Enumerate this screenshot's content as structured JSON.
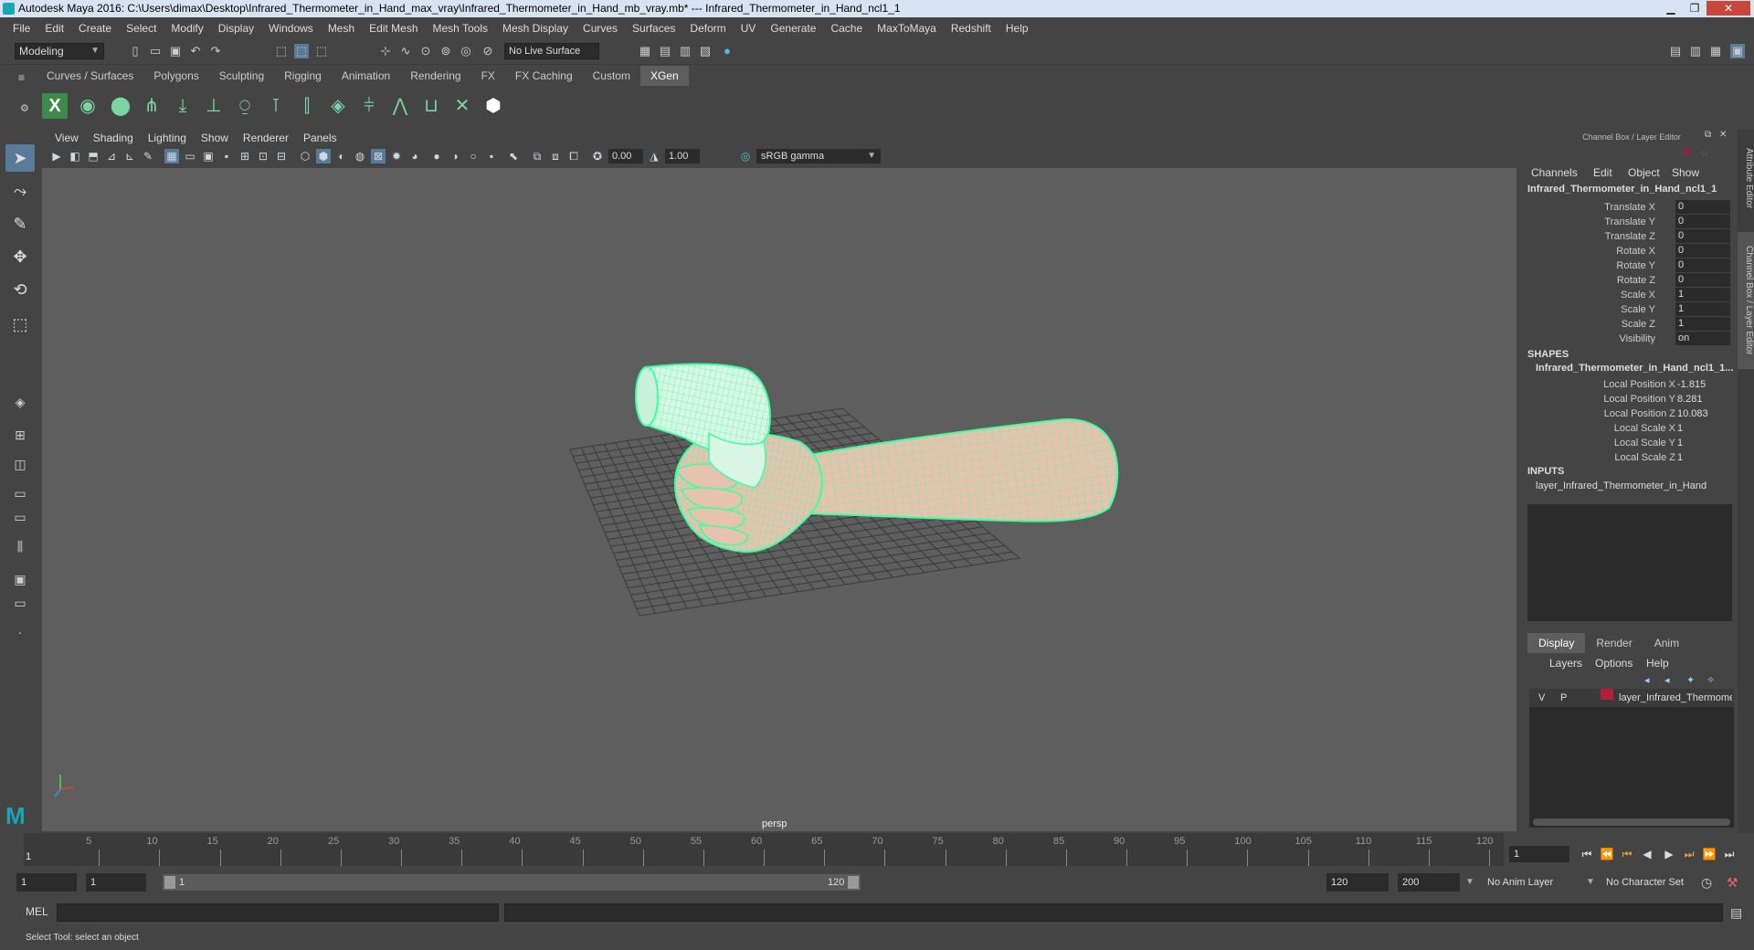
{
  "title": "Autodesk Maya 2016: C:\\Users\\dimax\\Desktop\\Infrared_Thermometer_in_Hand_max_vray\\Infrared_Thermometer_in_Hand_mb_vray.mb*   ---   Infrared_Thermometer_in_Hand_ncl1_1",
  "menu": [
    "File",
    "Edit",
    "Create",
    "Select",
    "Modify",
    "Display",
    "Windows",
    "Mesh",
    "Edit Mesh",
    "Mesh Tools",
    "Mesh Display",
    "Curves",
    "Surfaces",
    "Deform",
    "UV",
    "Generate",
    "Cache",
    "MaxToMaya",
    "Redshift",
    "Help"
  ],
  "status": {
    "mode": "Modeling",
    "live_surface": "No Live Surface"
  },
  "shelf_tabs": [
    "Curves / Surfaces",
    "Polygons",
    "Sculpting",
    "Rigging",
    "Animation",
    "Rendering",
    "FX",
    "FX Caching",
    "Custom",
    "XGen"
  ],
  "shelf_active": "XGen",
  "viewport": {
    "menu": [
      "View",
      "Shading",
      "Lighting",
      "Show",
      "Renderer",
      "Panels"
    ],
    "exposure": "0.00",
    "gamma_value": "1.00",
    "color_space": "sRGB gamma",
    "camera": "persp"
  },
  "channel_box": {
    "title": "Channel Box / Layer Editor",
    "menu": [
      "Channels",
      "Edit",
      "Object",
      "Show"
    ],
    "object": "Infrared_Thermometer_in_Hand_ncl1_1",
    "attrs": [
      {
        "label": "Translate X",
        "value": "0"
      },
      {
        "label": "Translate Y",
        "value": "0"
      },
      {
        "label": "Translate Z",
        "value": "0"
      },
      {
        "label": "Rotate X",
        "value": "0"
      },
      {
        "label": "Rotate Y",
        "value": "0"
      },
      {
        "label": "Rotate Z",
        "value": "0"
      },
      {
        "label": "Scale X",
        "value": "1"
      },
      {
        "label": "Scale Y",
        "value": "1"
      },
      {
        "label": "Scale Z",
        "value": "1"
      },
      {
        "label": "Visibility",
        "value": "on"
      }
    ],
    "shapes_header": "SHAPES",
    "shape_name": "Infrared_Thermometer_in_Hand_ncl1_1...",
    "shape_attrs": [
      {
        "label": "Local Position X",
        "value": "-1.815"
      },
      {
        "label": "Local Position Y",
        "value": "8.281"
      },
      {
        "label": "Local Position Z",
        "value": "10.083"
      },
      {
        "label": "Local Scale X",
        "value": "1"
      },
      {
        "label": "Local Scale Y",
        "value": "1"
      },
      {
        "label": "Local Scale Z",
        "value": "1"
      }
    ],
    "inputs_header": "INPUTS",
    "input_name": "layer_Infrared_Thermometer_in_Hand"
  },
  "layer_editor": {
    "tabs": [
      "Display",
      "Render",
      "Anim"
    ],
    "active_tab": "Display",
    "menu": [
      "Layers",
      "Options",
      "Help"
    ],
    "layer": {
      "v": "V",
      "p": "P",
      "name": "layer_Infrared_Thermome",
      "color": "#b0203a"
    }
  },
  "side_tabs": [
    "Attribute Editor",
    "Channel Box / Layer Editor"
  ],
  "timeline": {
    "ticks": [
      "5",
      "10",
      "15",
      "20",
      "25",
      "30",
      "35",
      "40",
      "45",
      "50",
      "55",
      "60",
      "65",
      "70",
      "75",
      "80",
      "85",
      "90",
      "95",
      "100",
      "105",
      "110",
      "115",
      "120"
    ],
    "current": "1",
    "current_field": "1"
  },
  "range": {
    "start": "1",
    "start2": "1",
    "slider_start": "1",
    "slider_end": "120",
    "end": "120",
    "end2": "200",
    "anim_layer": "No Anim Layer",
    "char_set": "No Character Set"
  },
  "mel": {
    "label": "MEL"
  },
  "help": "Select Tool: select an object",
  "colors": {
    "wire": "#3dffa0",
    "skin": "#e6c2b0",
    "viewport_bg": "#5e5e5e",
    "grid": "#3a3a3a"
  }
}
